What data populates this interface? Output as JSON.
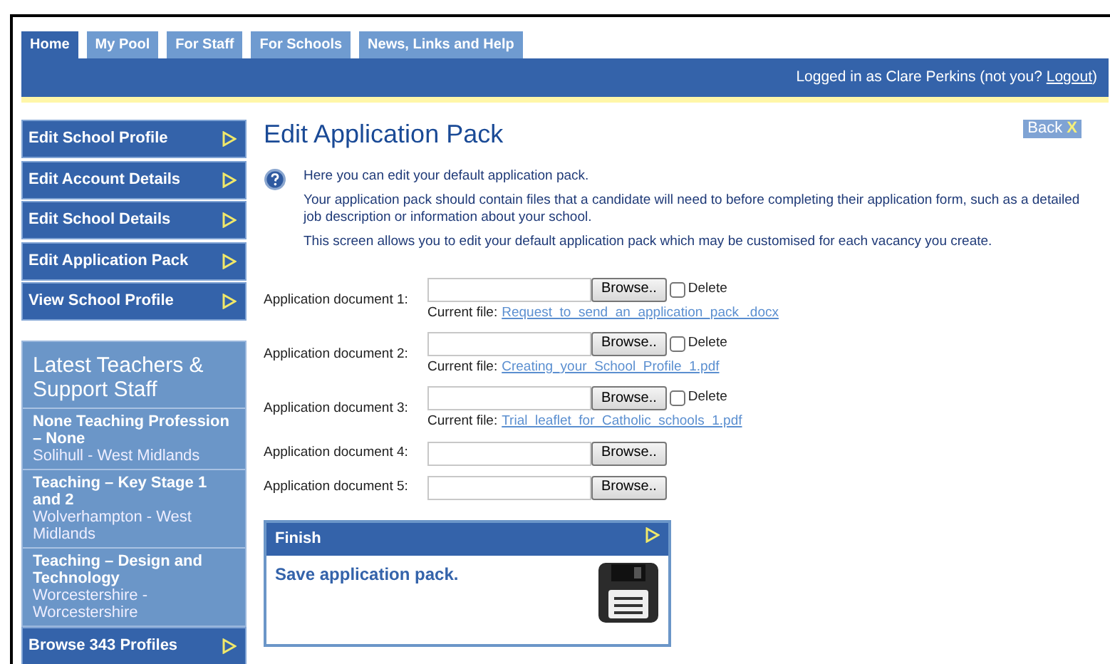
{
  "tabs": [
    {
      "label": "Home",
      "selected": true
    },
    {
      "label": "My Pool",
      "selected": false
    },
    {
      "label": "For Staff",
      "selected": false
    },
    {
      "label": "For Schools",
      "selected": false
    },
    {
      "label": "News, Links and Help",
      "selected": false
    }
  ],
  "login": {
    "before": "Logged in as Clare Perkins (not you? ",
    "link": "Logout",
    "after": ")"
  },
  "sidebar_menu": [
    {
      "label": "Edit School Profile"
    },
    {
      "label": "Edit Account Details"
    },
    {
      "label": "Edit School Details"
    },
    {
      "label": "Edit Application Pack"
    },
    {
      "label": "View School Profile"
    }
  ],
  "latest": {
    "title": "Latest Teachers & Support Staff",
    "profiles": [
      {
        "title": "None Teaching Profession – None",
        "location": "Solihull - West Midlands"
      },
      {
        "title": "Teaching – Key Stage 1 and 2",
        "location": "Wolverhampton - West Midlands"
      },
      {
        "title": "Teaching – Design and Technology",
        "location": "Worcestershire - Worcestershire"
      }
    ],
    "browse": "Browse 343 Profiles"
  },
  "page_title": "Edit Application Pack",
  "back": {
    "label": "Back",
    "mark": "X"
  },
  "intro": [
    "Here you can edit your default application pack.",
    "Your application pack should contain files that a candidate will need to before completing their application form, such as a detailed job description or information about your school.",
    "This screen allows you to edit your default application pack which may be customised for each vacancy you create."
  ],
  "documents": [
    {
      "label": "Application document 1:",
      "button": "Browse..",
      "delete": {
        "label": "Delete",
        "checked": false
      },
      "current_label": "Current file:",
      "current_file": "Request_to_send_an_application_pack_.docx"
    },
    {
      "label": "Application document 2:",
      "button": "Browse..",
      "delete": {
        "label": "Delete",
        "checked": false
      },
      "current_label": "Current file:",
      "current_file": "Creating_your_School_Profile_1.pdf"
    },
    {
      "label": "Application document 3:",
      "button": "Browse..",
      "delete": {
        "label": "Delete",
        "checked": false
      },
      "current_label": "Current file:",
      "current_file": "Trial_leaflet_for_Catholic_schools_1.pdf"
    },
    {
      "label": "Application document 4:",
      "button": "Browse.."
    },
    {
      "label": "Application document 5:",
      "button": "Browse.."
    }
  ],
  "finish": {
    "header": "Finish",
    "text": "Save application pack."
  }
}
